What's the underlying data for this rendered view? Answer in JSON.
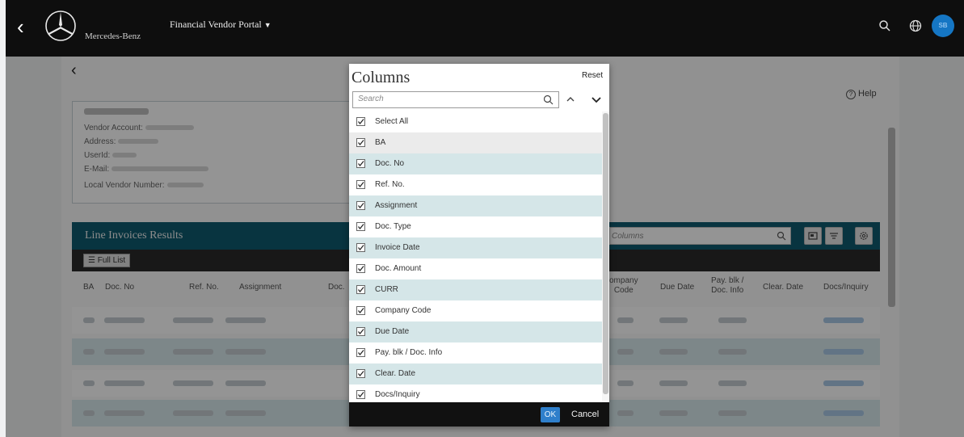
{
  "header": {
    "brand": "Mercedes-Benz",
    "portal_title": "Financial Vendor Portal",
    "portal_caret": "▼",
    "avatar_initials": "SB"
  },
  "page": {
    "help_label": "Help",
    "vendor_fields": [
      "Vendor Account:",
      "Address:",
      "UserId:",
      "E-Mail:",
      "Local Vendor Number:"
    ],
    "results_title": "Line Invoices Results",
    "column_search_placeholder": "Columns",
    "full_list_label": "Full List",
    "table_headers": [
      "BA",
      "Doc. No",
      "Ref. No.",
      "Assignment",
      "Doc.",
      "ompany\nCode",
      "Due Date",
      "Pay. blk /\nDoc. Info",
      "Clear. Date",
      "Docs/Inquiry"
    ]
  },
  "modal": {
    "title": "Columns",
    "reset_label": "Reset",
    "search_placeholder": "Search",
    "items": [
      {
        "label": "Select All",
        "checked": true
      },
      {
        "label": "BA",
        "checked": true
      },
      {
        "label": "Doc. No",
        "checked": true
      },
      {
        "label": "Ref. No.",
        "checked": true
      },
      {
        "label": "Assignment",
        "checked": true
      },
      {
        "label": "Doc. Type",
        "checked": true
      },
      {
        "label": "Invoice Date",
        "checked": true
      },
      {
        "label": "Doc. Amount",
        "checked": true
      },
      {
        "label": "CURR",
        "checked": true
      },
      {
        "label": "Company Code",
        "checked": true
      },
      {
        "label": "Due Date",
        "checked": true
      },
      {
        "label": "Pay. blk / Doc. Info",
        "checked": true
      },
      {
        "label": "Clear. Date",
        "checked": true
      },
      {
        "label": "Docs/Inquiry",
        "checked": true
      }
    ],
    "ok_label": "OK",
    "cancel_label": "Cancel"
  },
  "colors": {
    "topbar": "#0e0e0e",
    "results_bar": "#0e5a6e",
    "row_alt": "#d5e6e8",
    "ok_button": "#2f7fcb"
  }
}
